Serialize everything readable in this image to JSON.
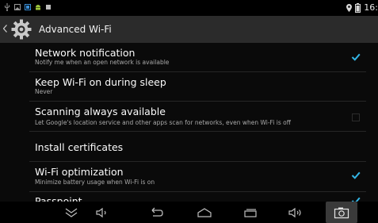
{
  "status_bar": {
    "time": "16:",
    "icons": [
      "usb-icon",
      "image-icon",
      "screenshot-icon",
      "android-icon",
      "square-icon",
      "location-icon",
      "battery-icon"
    ]
  },
  "action_bar": {
    "title": "Advanced Wi-Fi",
    "icon": "settings-gear-icon"
  },
  "settings": [
    {
      "title": "Network notification",
      "summary": "Notify me when an open network is available",
      "checkbox": true
    },
    {
      "title": "Keep Wi-Fi on during sleep",
      "summary": "Never"
    },
    {
      "title": "Scanning always available",
      "summary": "Let Google's location service and other apps scan for networks, even when Wi-Fi is off",
      "checkbox": false
    },
    {
      "title": "Install certificates"
    },
    {
      "title": "Wi-Fi optimization",
      "summary": "Minimize battery usage when Wi-Fi is on",
      "checkbox": true
    },
    {
      "title": "Passpoint",
      "checkbox": true
    }
  ],
  "nav_bar": {
    "buttons": [
      "hide-keyboard-icon",
      "volume-down-icon",
      "back-icon",
      "home-icon",
      "recent-apps-icon",
      "volume-up-icon",
      "screenshot-camera-icon"
    ]
  },
  "colors": {
    "accent": "#33b5e5",
    "action_bar": "#2b2b2b",
    "background": "#0a0a0a"
  }
}
